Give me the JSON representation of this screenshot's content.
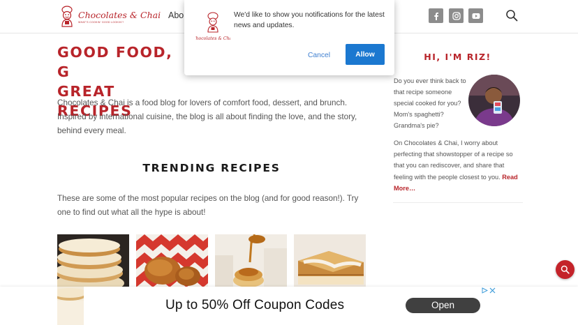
{
  "header": {
    "logo_title": "Chocolates & Chai",
    "logo_tagline": "WHAT'S COOKIN' GOOD LOOKIN'?",
    "nav_about": "Abou",
    "social": [
      {
        "icon": "facebook-icon",
        "glyph": "f"
      },
      {
        "icon": "instagram-icon",
        "glyph": ""
      },
      {
        "icon": "youtube-icon",
        "glyph": ""
      }
    ]
  },
  "main": {
    "hero_title": "GOOD FOOD, G\nGREAT RECIPES",
    "intro": "Chocolates & Chai is a food blog for lovers of comfort food, dessert, and brunch. Inspired by international cuisine, the blog is all about finding the love, and the story, behind every meal.",
    "trending_title": "TRENDING RECIPES",
    "trending_desc": "These are some of the most popular recipes on the blog (and for good reason!). Try one to find out what all the hype is about!"
  },
  "sidebar": {
    "title": "HI, I'M RIZ!",
    "text1": "Do you ever think back to that recipe someone special cooked for you? Mom's spaghetti? Grandma's pie?",
    "text2": "On Chocolates & Chai, I worry about perfecting that showstopper of a recipe so that you can rediscover, and share that feeling with the people closest to you.",
    "read_more": "Read More…"
  },
  "popup": {
    "message": "We'd like to show you notifications for the latest news and updates.",
    "cancel_label": "Cancel",
    "allow_label": "Allow"
  },
  "ad": {
    "headline": "Up to 50% Off Coupon Codes",
    "cta": "Open"
  },
  "colors": {
    "brand_red": "#b8242a",
    "allow_blue": "#1b78d0",
    "social_gray": "#8c8c8c"
  }
}
